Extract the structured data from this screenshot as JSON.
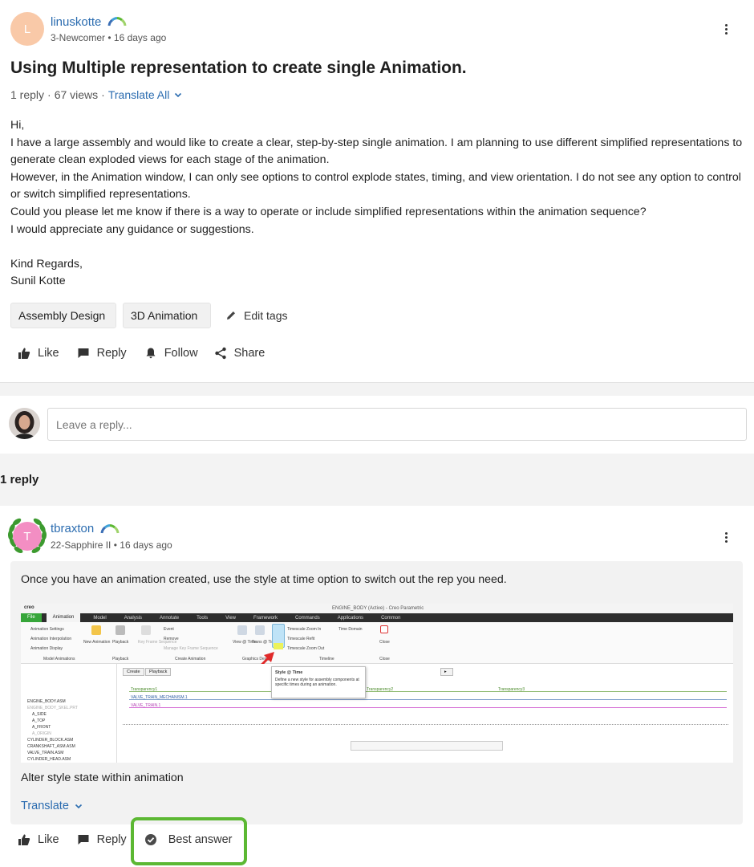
{
  "post": {
    "author": {
      "initial": "L",
      "username": "linuskotte",
      "rank": "3-Newcomer",
      "age": "16 days ago"
    },
    "title": "Using Multiple representation to create single Animation.",
    "stats": {
      "replies": "1 reply",
      "views": "67 views",
      "separator": "·",
      "translate_label": "Translate All"
    },
    "body": [
      "Hi,",
      "I have a large assembly and would like to create a clear, step-by-step single animation. I am planning to use different simplified representations to generate clean exploded views for each stage of the animation.",
      "However, in the Animation window, I can only see options to control explode states, timing, and view orientation. I do not see any option to control or switch simplified representations.",
      "Could you please let me know if there is a way to operate or include simplified representations within the animation sequence?",
      "I would appreciate any guidance or suggestions.",
      "",
      "Kind Regards,",
      "Sunil Kotte"
    ],
    "tags": [
      "Assembly Design",
      "3D Animation"
    ],
    "edit_tags_label": "Edit tags",
    "actions": {
      "like": "Like",
      "reply": "Reply",
      "follow": "Follow",
      "share": "Share"
    }
  },
  "reply_box": {
    "placeholder": "Leave a reply..."
  },
  "reply_count_label": "1 reply",
  "reply": {
    "author": {
      "initial": "T",
      "username": "tbraxton",
      "rank": "22-Sapphire II",
      "age": "16 days ago"
    },
    "text": "Once you have an animation created, use the style at time option to switch out the rep you need.",
    "image": {
      "window_title": "ENGINE_BODY (Active) - Creo Parametric",
      "app_logo": "creo",
      "menu_tabs": [
        "File",
        "Animation",
        "Model",
        "Analysis",
        "Annotate",
        "Tools",
        "View",
        "Framework",
        "Commands",
        "Applications",
        "Common"
      ],
      "ribbon_items": [
        "Animation Settings",
        "Animation Interpolation",
        "Animation Display",
        "New Animation",
        "Playback",
        "Key Frame Sequence",
        "Event",
        "Remove",
        "Manage Key Frame Sequence",
        "View @ Time",
        "Trans @ Time",
        "Style @ Time",
        "Timescale Zoom In",
        "Timescale Refit",
        "Timescale Zoom Out",
        "Time Domain",
        "Close"
      ],
      "ribbon_groups": [
        "Model Animations",
        "Playback",
        "Create Animation",
        "Graphics Design",
        "Timeline",
        "Close"
      ],
      "tooltip_title": "Style @ Time",
      "tooltip_text": "Define a new style for assembly components at specific times during an animation.",
      "timeline_buttons": [
        "Create",
        "Playback"
      ],
      "timeline_tracks": [
        "Transparency1",
        "VALVE_TRAIN_MECHANISM.1",
        "VALVE_TRAIN.1"
      ],
      "timeline_markers": [
        "Transparency2",
        "Transparency3"
      ],
      "tree_items": [
        "ENGINE_BODY.ASM",
        "ENGINE_BODY_SKEL.PRT",
        "A_SIDE",
        "A_TOP",
        "A_FRONT",
        "A_ORIGIN",
        "CYLINDER_BLOCK.ASM",
        "CRANKSHAFT_ASM.ASM",
        "VALVE_TRAIN.ASM",
        "CYLINDER_HEAD.ASM"
      ]
    },
    "caption": "Alter style state within animation",
    "translate_label": "Translate",
    "actions": {
      "like": "Like",
      "reply": "Reply",
      "best_answer": "Best answer"
    }
  },
  "colors": {
    "link": "#2b6cb0",
    "highlight": "#5cb833",
    "creo_green": "#37a63a"
  }
}
